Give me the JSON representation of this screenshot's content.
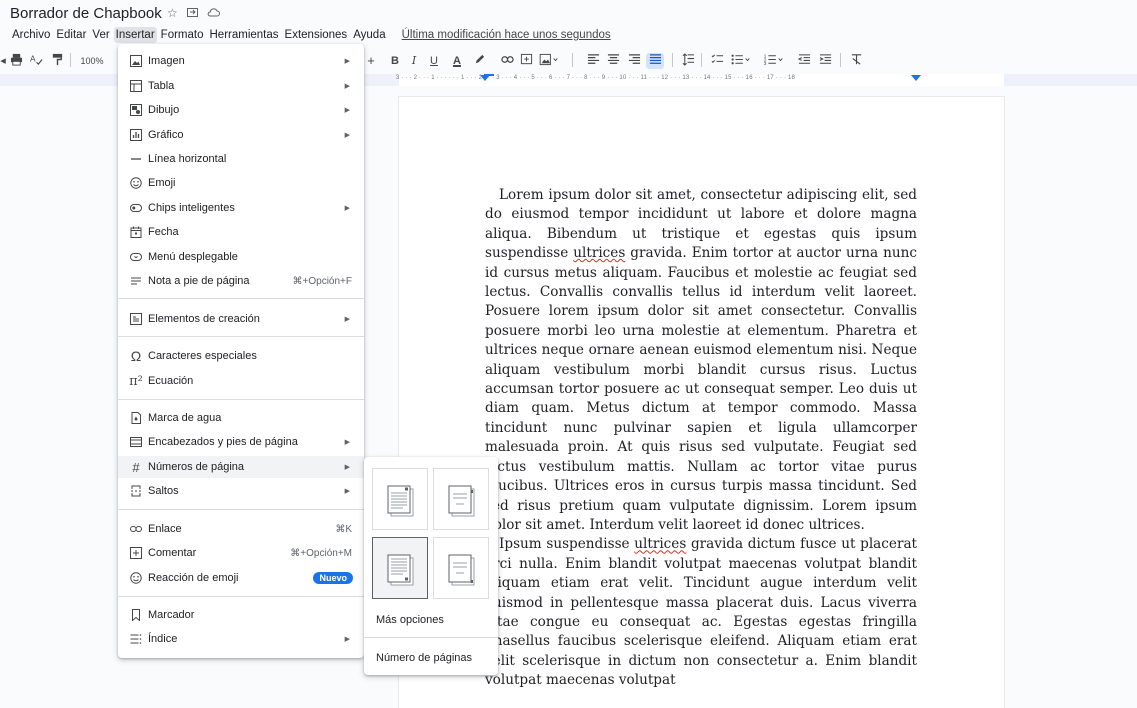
{
  "title": "Borrador de Chapbook",
  "title_icons": [
    "star-icon",
    "folder-move-icon",
    "cloud-status-icon"
  ],
  "menubar": {
    "items": [
      "Archivo",
      "Editar",
      "Ver",
      "Insertar",
      "Formato",
      "Herramientas",
      "Extensiones",
      "Ayuda"
    ],
    "active": "Insertar",
    "last_modified": "Última modificación hace unos segundos"
  },
  "toolbar": {
    "zoom": "100%",
    "plus": "+",
    "bold": "B",
    "italic": "I",
    "underline": "U",
    "text_color": "A"
  },
  "ruler": {
    "labels": "3 · · · 2 · · · 1 · · ·   · · · 1 · · · 2 · · · 3 · · · 4 · · · 5 · · · 6 · · · 7 · · · 8 · · · 9 · · · 10 · · · 11 · · · 12 · · · 13 · · · 14 · · · 15 · · · 16 · · · 17 · · · 18"
  },
  "insert_menu": {
    "items": [
      {
        "label": "Imagen",
        "icon": "image-icon",
        "submenu": true
      },
      {
        "label": "Tabla",
        "icon": "table-icon",
        "submenu": true
      },
      {
        "label": "Dibujo",
        "icon": "drawing-icon",
        "submenu": true
      },
      {
        "label": "Gráfico",
        "icon": "chart-icon",
        "submenu": true
      },
      {
        "label": "Línea horizontal",
        "icon": "horizontal-line-icon"
      },
      {
        "label": "Emoji",
        "icon": "emoji-icon"
      },
      {
        "label": "Chips inteligentes",
        "icon": "smart-chip-icon",
        "submenu": true
      },
      {
        "label": "Fecha",
        "icon": "calendar-icon"
      },
      {
        "label": "Menú desplegable",
        "icon": "dropdown-icon"
      },
      {
        "label": "Nota a pie de página",
        "icon": "footnote-icon",
        "shortcut": "⌘+Opción+F"
      },
      {
        "label": "Elementos de creación",
        "icon": "building-blocks-icon",
        "submenu": true
      },
      {
        "label": "Caracteres especiales",
        "icon": "omega-icon"
      },
      {
        "label": "Ecuación",
        "icon": "pi-icon"
      },
      {
        "label": "Marca de agua",
        "icon": "watermark-icon"
      },
      {
        "label": "Encabezados y pies de página",
        "icon": "header-footer-icon",
        "submenu": true
      },
      {
        "label": "Números de página",
        "icon": "hash-icon",
        "submenu": true,
        "highlighted": true
      },
      {
        "label": "Saltos",
        "icon": "break-icon",
        "submenu": true
      },
      {
        "label": "Enlace",
        "icon": "link-icon",
        "shortcut": "⌘K"
      },
      {
        "label": "Comentar",
        "icon": "comment-add-icon",
        "shortcut": "⌘+Opción+M"
      },
      {
        "label": "Reacción de emoji",
        "icon": "emoji-reaction-icon",
        "badge": "Nuevo"
      },
      {
        "label": "Marcador",
        "icon": "bookmark-icon"
      },
      {
        "label": "Índice",
        "icon": "table-of-contents-icon",
        "submenu": true
      }
    ]
  },
  "page_numbers_submenu": {
    "more_options": "Más opciones",
    "page_count": "Número de páginas"
  },
  "document": {
    "paragraphs": [
      "Lorem ipsum dolor sit amet, consectetur adipiscing elit, sed do eiusmod tempor incididunt ut labore et dolore magna aliqua. Bibendum ut tristique et egestas quis ipsum suspendisse ultrices gravida. Enim tortor at auctor urna nunc id cursus metus aliquam. Faucibus et molestie ac feugiat sed lectus. Convallis convallis tellus id interdum velit laoreet. Posuere lorem ipsum dolor sit amet consectetur. Convallis posuere morbi leo urna molestie at elementum. Pharetra et ultrices neque ornare aenean euismod elementum nisi. Neque aliquam vestibulum morbi blandit cursus risus. Luctus accumsan tortor posuere ac ut consequat semper. Leo duis ut diam quam. Metus dictum at tempor commodo. Massa tincidunt nunc pulvinar sapien et ligula ullamcorper malesuada proin. At quis risus sed vulputate. Feugiat sed lectus vestibulum mattis. Nullam ac tortor vitae purus faucibus. Ultrices eros in cursus turpis massa tincidunt. Sed sed risus pretium quam vulputate dignissim. Lorem ipsum dolor sit amet. Interdum velit laoreet id donec ultrices.",
      "Ipsum suspendisse ultrices gravida dictum fusce ut placerat orci nulla. Enim blandit volutpat maecenas volutpat blandit aliquam etiam erat velit. Tincidunt augue interdum velit euismod in pellentesque massa placerat duis. Lacus viverra vitae congue eu consequat ac. Egestas egestas fringilla phasellus faucibus scelerisque eleifend. Aliquam etiam erat velit scelerisque in dictum non consectetur a. Enim blandit volutpat maecenas volutpat"
    ]
  }
}
